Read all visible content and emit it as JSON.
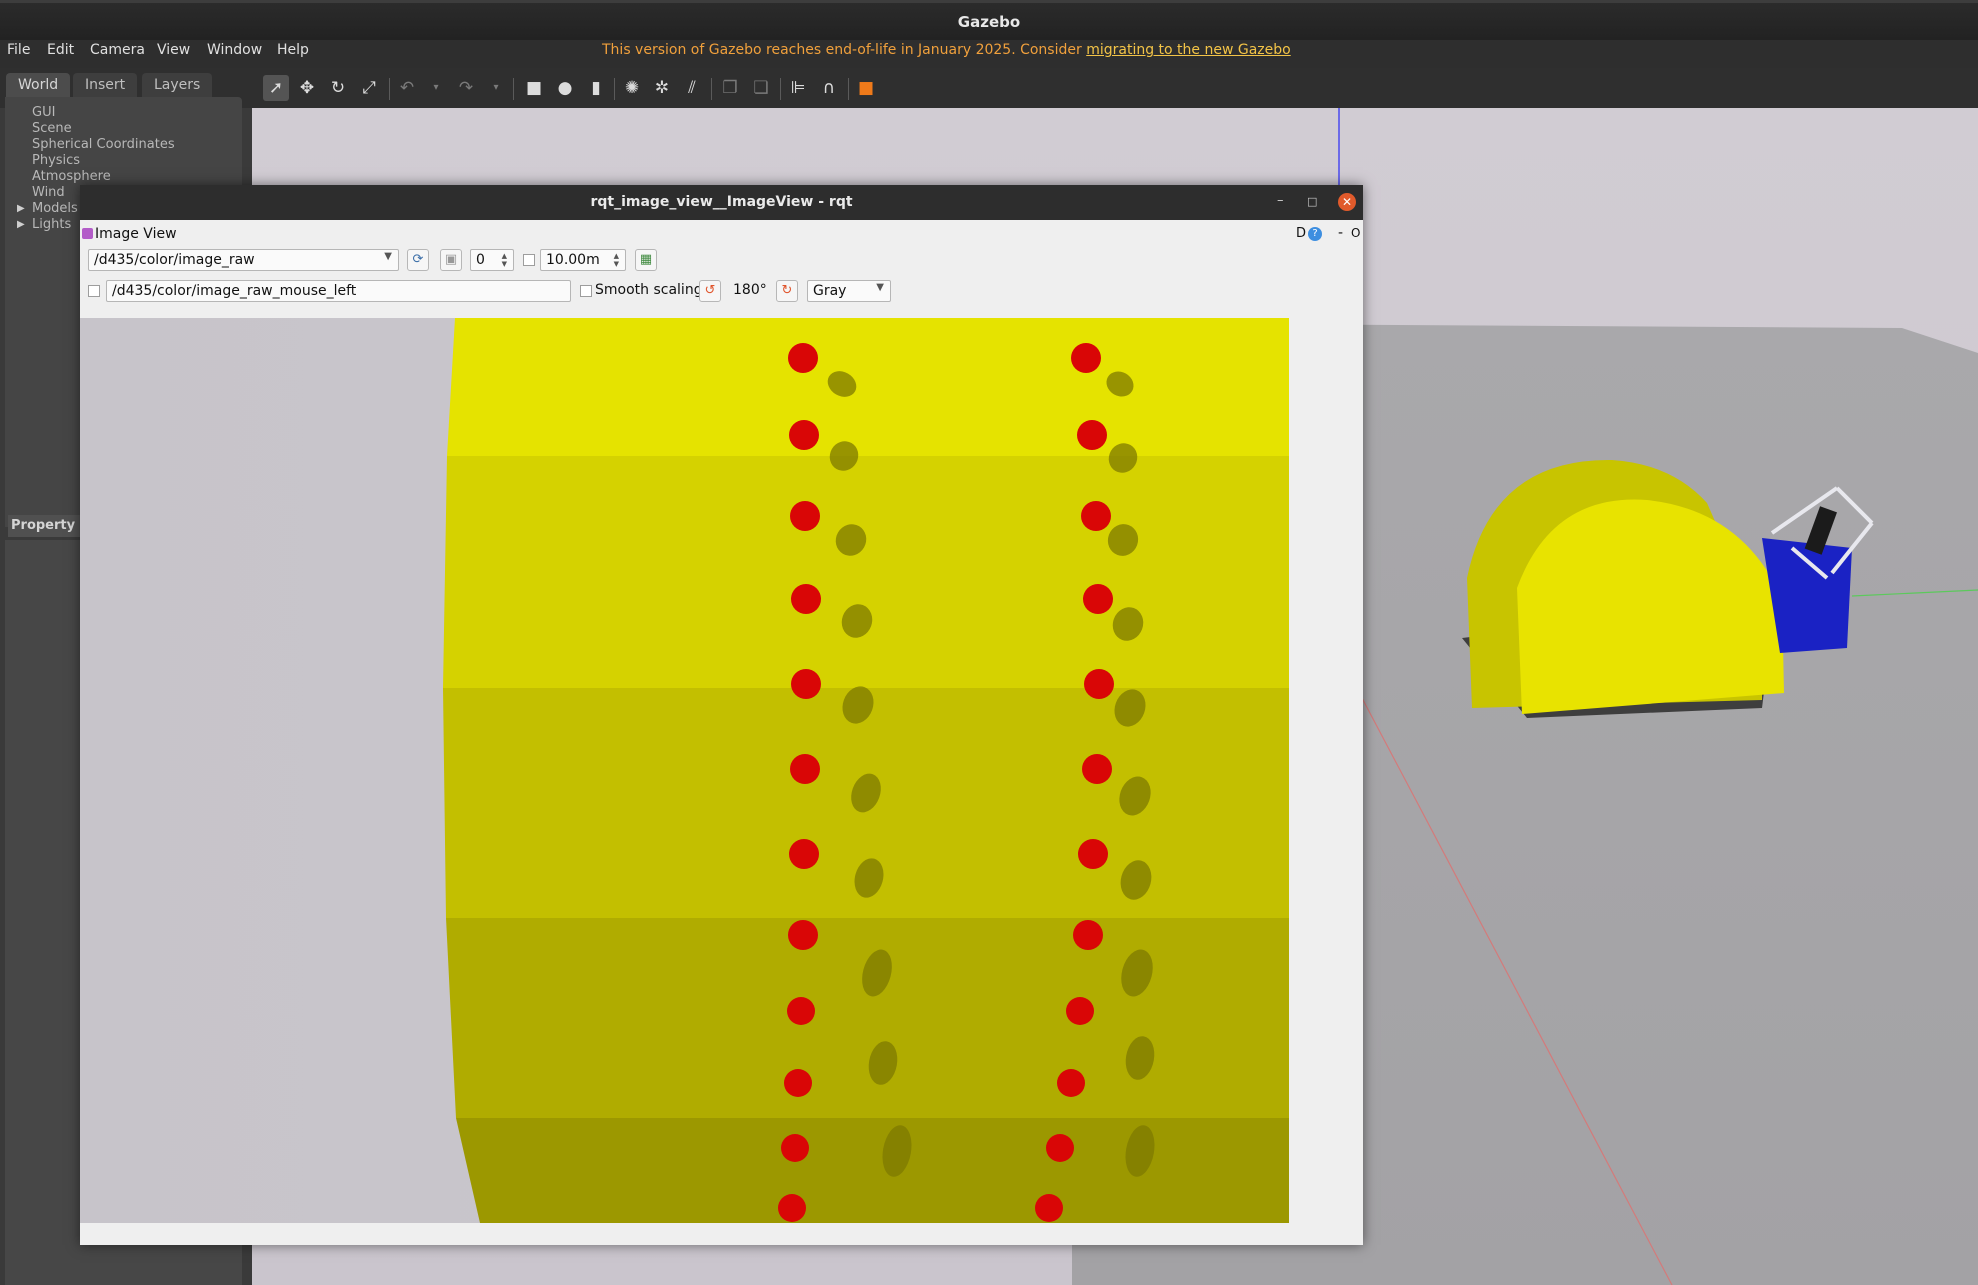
{
  "window": {
    "title": "Gazebo"
  },
  "menu": {
    "items": [
      "File",
      "Edit",
      "Camera",
      "View",
      "Window",
      "Help"
    ],
    "notice": "This version of Gazebo reaches end-of-life in January 2025. Consider ",
    "notice_link": "migrating to the new Gazebo"
  },
  "sidebar": {
    "tabs": [
      "World",
      "Insert",
      "Layers"
    ],
    "tree": [
      "GUI",
      "Scene",
      "Spherical Coordinates",
      "Physics",
      "Atmosphere",
      "Wind",
      "Models",
      "Lights"
    ],
    "property_label": "Property"
  },
  "toolbar": {
    "icons": [
      "select-arrow-icon",
      "translate-icon",
      "rotate-icon",
      "scale-icon",
      "undo-icon",
      "redo-icon",
      "box-icon",
      "sphere-icon",
      "cylinder-icon",
      "point-light-icon",
      "spot-light-icon",
      "directional-light-icon",
      "copy-icon",
      "paste-icon",
      "align-icon",
      "snap-icon",
      "record-icon"
    ]
  },
  "rqt": {
    "title": "rqt_image_view__ImageView - rqt",
    "plugin_title": "Image View",
    "right_controls": "D",
    "topic": "/d435/color/image_raw",
    "spin_value": "0",
    "distance_value": "10.00m",
    "mouse_topic": "/d435/color/image_raw_mouse_left",
    "smooth_scaling_label": "Smooth scaling",
    "rotation_label": "180°",
    "colormap": "Gray"
  },
  "colors": {
    "accent_notice": "#f0a03c",
    "rqt_close": "#e05a2b",
    "panel_yellow": "#e6e400",
    "dot_red": "#d40000",
    "robot_blue": "#1620c8"
  }
}
